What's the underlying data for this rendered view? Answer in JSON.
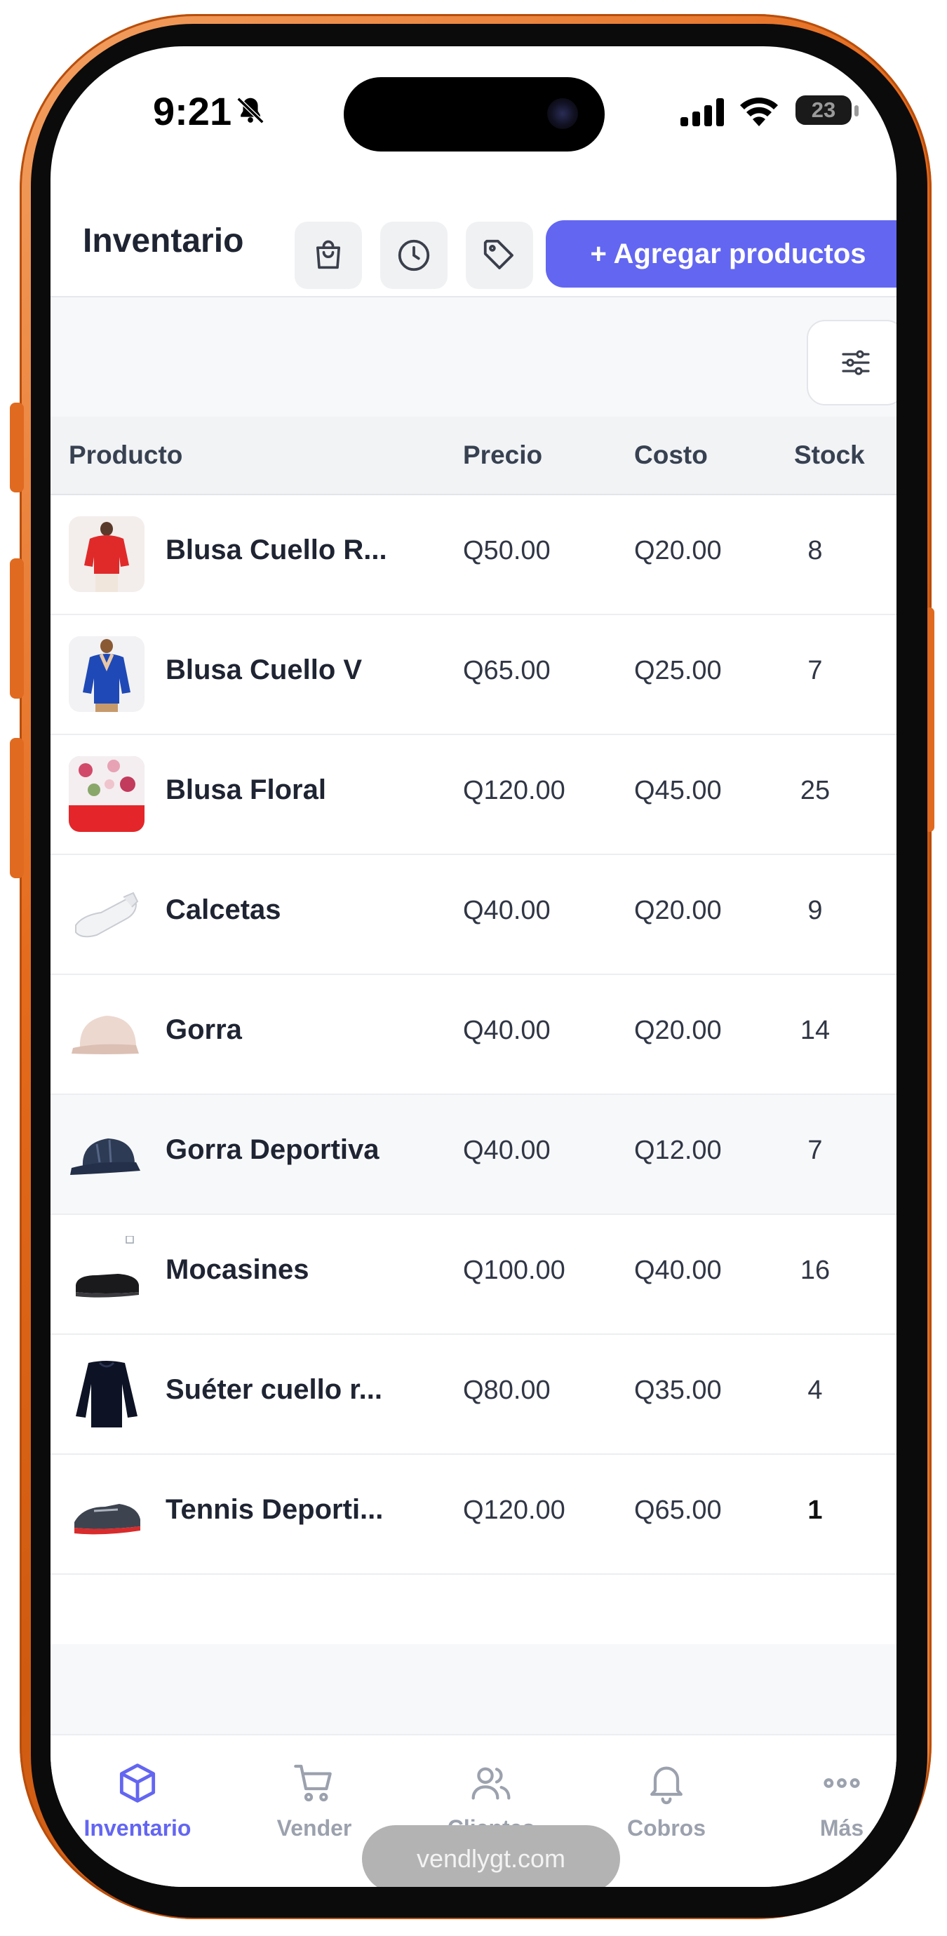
{
  "status_bar": {
    "time": "9:21",
    "battery": "23"
  },
  "header": {
    "title": "Inventario",
    "add_button": "+ Agregar productos",
    "icons": [
      "shopping-bag-icon",
      "clock-icon",
      "tag-icon"
    ]
  },
  "table": {
    "columns": {
      "product": "Producto",
      "price": "Precio",
      "cost": "Costo",
      "stock": "Stock"
    },
    "rows": [
      {
        "name": "Blusa Cuello R...",
        "price": "Q50.00",
        "cost": "Q20.00",
        "stock": "8"
      },
      {
        "name": "Blusa Cuello V",
        "price": "Q65.00",
        "cost": "Q25.00",
        "stock": "7"
      },
      {
        "name": "Blusa Floral",
        "price": "Q120.00",
        "cost": "Q45.00",
        "stock": "25"
      },
      {
        "name": "Calcetas",
        "price": "Q40.00",
        "cost": "Q20.00",
        "stock": "9"
      },
      {
        "name": "Gorra",
        "price": "Q40.00",
        "cost": "Q20.00",
        "stock": "14"
      },
      {
        "name": "Gorra Deportiva",
        "price": "Q40.00",
        "cost": "Q12.00",
        "stock": "7"
      },
      {
        "name": "Mocasines",
        "price": "Q100.00",
        "cost": "Q40.00",
        "stock": "16"
      },
      {
        "name": "Suéter cuello r...",
        "price": "Q80.00",
        "cost": "Q35.00",
        "stock": "4"
      },
      {
        "name": "Tennis Deporti...",
        "price": "Q120.00",
        "cost": "Q65.00",
        "stock": "1"
      }
    ]
  },
  "bottom_nav": [
    {
      "label": "Inventario",
      "icon": "box-icon",
      "active": true
    },
    {
      "label": "Vender",
      "icon": "cart-icon"
    },
    {
      "label": "Clientes",
      "icon": "users-icon"
    },
    {
      "label": "Cobros",
      "icon": "bell-icon"
    },
    {
      "label": "Más",
      "icon": "more-icon"
    }
  ],
  "url": "vendlygt.com",
  "colors": {
    "accent": "#6366f1",
    "frame": "#e46a1c"
  }
}
